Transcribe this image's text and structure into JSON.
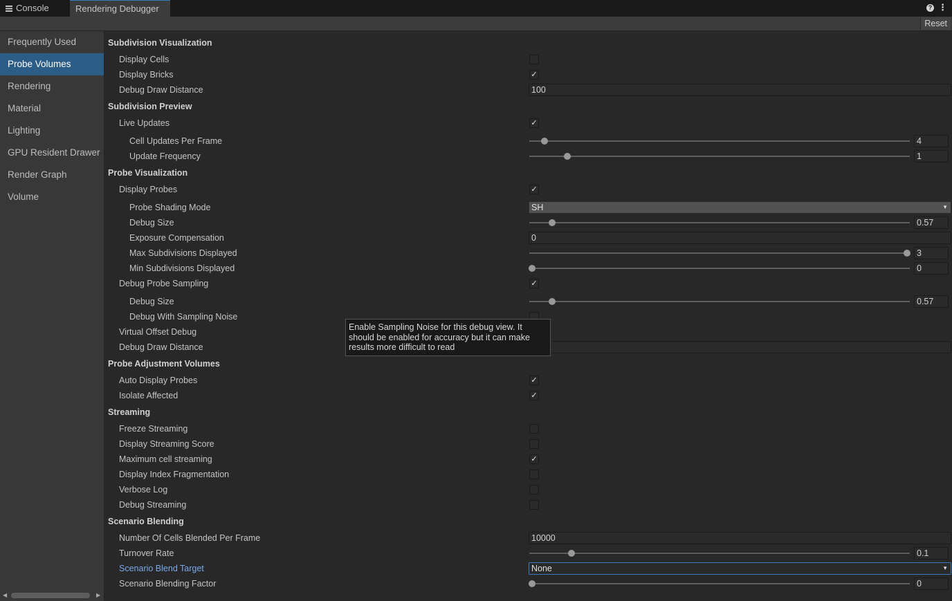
{
  "tabs": {
    "console": "Console",
    "rendering_debugger": "Rendering Debugger"
  },
  "toolbar": {
    "reset_label": "Reset"
  },
  "sidebar": {
    "items": [
      {
        "label": "Frequently Used"
      },
      {
        "label": "Probe Volumes"
      },
      {
        "label": "Rendering"
      },
      {
        "label": "Material"
      },
      {
        "label": "Lighting"
      },
      {
        "label": "GPU Resident Drawer"
      },
      {
        "label": "Render Graph"
      },
      {
        "label": "Volume"
      }
    ],
    "selected": "Probe Volumes"
  },
  "colors": {
    "selected_bg": "#2c5d87",
    "focus_border": "#3a79bb",
    "link_label": "#7aa9e8"
  },
  "sections": {
    "subdivision_visualization": {
      "title": "Subdivision Visualization",
      "display_cells": {
        "label": "Display Cells",
        "checked": false
      },
      "display_bricks": {
        "label": "Display Bricks",
        "checked": true
      },
      "debug_draw_distance": {
        "label": "Debug Draw Distance",
        "value": "100"
      }
    },
    "subdivision_preview": {
      "title": "Subdivision Preview",
      "live_updates": {
        "label": "Live Updates",
        "checked": true
      },
      "cell_updates_per_frame": {
        "label": "Cell Updates Per Frame",
        "value": "4",
        "fraction": 0.04
      },
      "update_frequency": {
        "label": "Update Frequency",
        "value": "1",
        "fraction": 0.1
      }
    },
    "probe_visualization": {
      "title": "Probe Visualization",
      "display_probes": {
        "label": "Display Probes",
        "checked": true
      },
      "probe_shading_mode": {
        "label": "Probe Shading Mode",
        "value": "SH"
      },
      "debug_size": {
        "label": "Debug Size",
        "value": "0.57",
        "fraction": 0.06
      },
      "exposure_compensation": {
        "label": "Exposure Compensation",
        "value": "0"
      },
      "max_subdivisions": {
        "label": "Max Subdivisions Displayed",
        "value": "3",
        "fraction": 0.993
      },
      "min_subdivisions": {
        "label": "Min Subdivisions Displayed",
        "value": "0",
        "fraction": 0.008
      },
      "debug_probe_sampling": {
        "label": "Debug Probe Sampling",
        "checked": true
      },
      "debug_size_2": {
        "label": "Debug Size",
        "value": "0.57",
        "fraction": 0.06
      },
      "debug_with_sampling_noise": {
        "label": "Debug With Sampling Noise",
        "checked": false
      },
      "virtual_offset_debug": {
        "label": "Virtual Offset Debug"
      },
      "debug_draw_distance": {
        "label": "Debug Draw Distance",
        "value": ""
      }
    },
    "probe_adjustment_volumes": {
      "title": "Probe Adjustment Volumes",
      "auto_display_probes": {
        "label": "Auto Display Probes",
        "checked": true
      },
      "isolate_affected": {
        "label": "Isolate Affected",
        "checked": true
      }
    },
    "streaming": {
      "title": "Streaming",
      "freeze_streaming": {
        "label": "Freeze Streaming",
        "checked": false
      },
      "display_streaming_score": {
        "label": "Display Streaming Score",
        "checked": false
      },
      "maximum_cell_streaming": {
        "label": "Maximum cell streaming",
        "checked": true
      },
      "display_index_fragmentation": {
        "label": "Display Index Fragmentation",
        "checked": false
      },
      "verbose_log": {
        "label": "Verbose Log",
        "checked": false
      },
      "debug_streaming": {
        "label": "Debug Streaming",
        "checked": false
      }
    },
    "scenario_blending": {
      "title": "Scenario Blending",
      "cells_blended": {
        "label": "Number Of Cells Blended Per Frame",
        "value": "10000"
      },
      "turnover_rate": {
        "label": "Turnover Rate",
        "value": "0.1",
        "fraction": 0.11
      },
      "scenario_blend_target": {
        "label": "Scenario Blend Target",
        "value": "None"
      },
      "scenario_blending_factor": {
        "label": "Scenario Blending Factor",
        "value": "0",
        "fraction": 0.008
      }
    }
  },
  "tooltip": {
    "text": "Enable Sampling Noise for this debug view. It should be enabled for accuracy but it can make results more difficult to read"
  },
  "icons": {
    "console": "console-icon",
    "help": "help-icon",
    "more": "more-menu-icon",
    "check": "checkmark-icon",
    "dropdown": "chevron-down-icon"
  }
}
